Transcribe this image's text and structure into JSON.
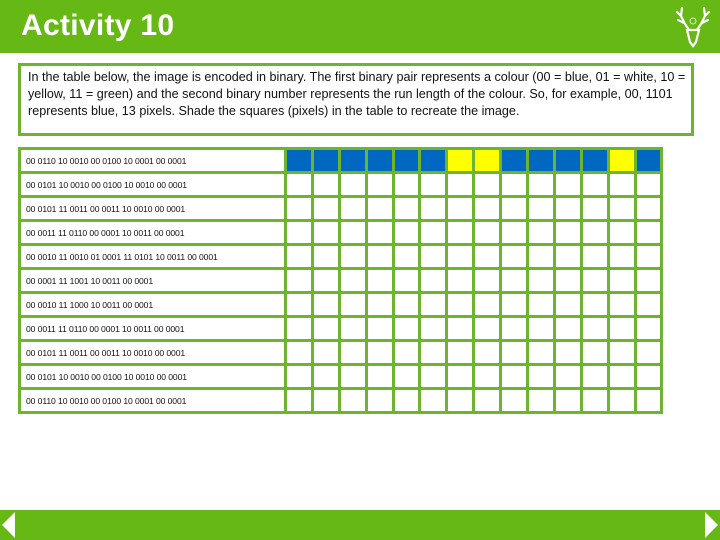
{
  "header": {
    "title": "Activity 10",
    "logo_icon": "stag-head-icon"
  },
  "instructions": {
    "text": "In the table below, the image is encoded in binary. The first binary pair represents a colour (00 = blue, 01 = white, 10 = yellow, 11 = green) and the second binary number represents the run length of the colour.  So, for example, 00, 1101 represents blue, 13 pixels.  Shade the squares (pixels) in the table to recreate the image."
  },
  "palette": {
    "blue": "#0068c0",
    "white": "#ffffff",
    "yellow": "#ffff00",
    "green": "#66b814",
    "grid_border": "#6db52e"
  },
  "grid": {
    "columns": 14,
    "rows": [
      {
        "code": "00 0110 10 0010 00 0100 10 0001 00 0001",
        "cells": [
          "blue",
          "blue",
          "blue",
          "blue",
          "blue",
          "blue",
          "yellow",
          "yellow",
          "blue",
          "blue",
          "blue",
          "blue",
          "yellow",
          "blue"
        ]
      },
      {
        "code": "00 0101 10 0010 00 0100 10 0010 00 0001",
        "cells": []
      },
      {
        "code": "00 0101 11 0011 00 0011 10 0010 00 0001",
        "cells": []
      },
      {
        "code": "00 0011 11 0110 00 0001 10 0011 00 0001",
        "cells": []
      },
      {
        "code": "00 0010 11 0010 01 0001 11 0101 10 0011 00 0001",
        "cells": []
      },
      {
        "code": "00 0001 11 1001 10 0011 00 0001",
        "cells": []
      },
      {
        "code": "00 0010 11 1000 10 0011 00 0001",
        "cells": []
      },
      {
        "code": "00 0011 11 0110 00 0001 10 0011 00 0001",
        "cells": []
      },
      {
        "code": "00 0101 11 0011 00 0011 10 0010 00 0001",
        "cells": []
      },
      {
        "code": "00 0101 10 0010 00 0100 10 0010 00 0001",
        "cells": []
      },
      {
        "code": "00 0110 10 0010 00 0100 10 0001 00 0001",
        "cells": []
      }
    ]
  },
  "footer": {
    "prev_icon": "previous-slide-icon",
    "next_icon": "next-slide-icon"
  }
}
